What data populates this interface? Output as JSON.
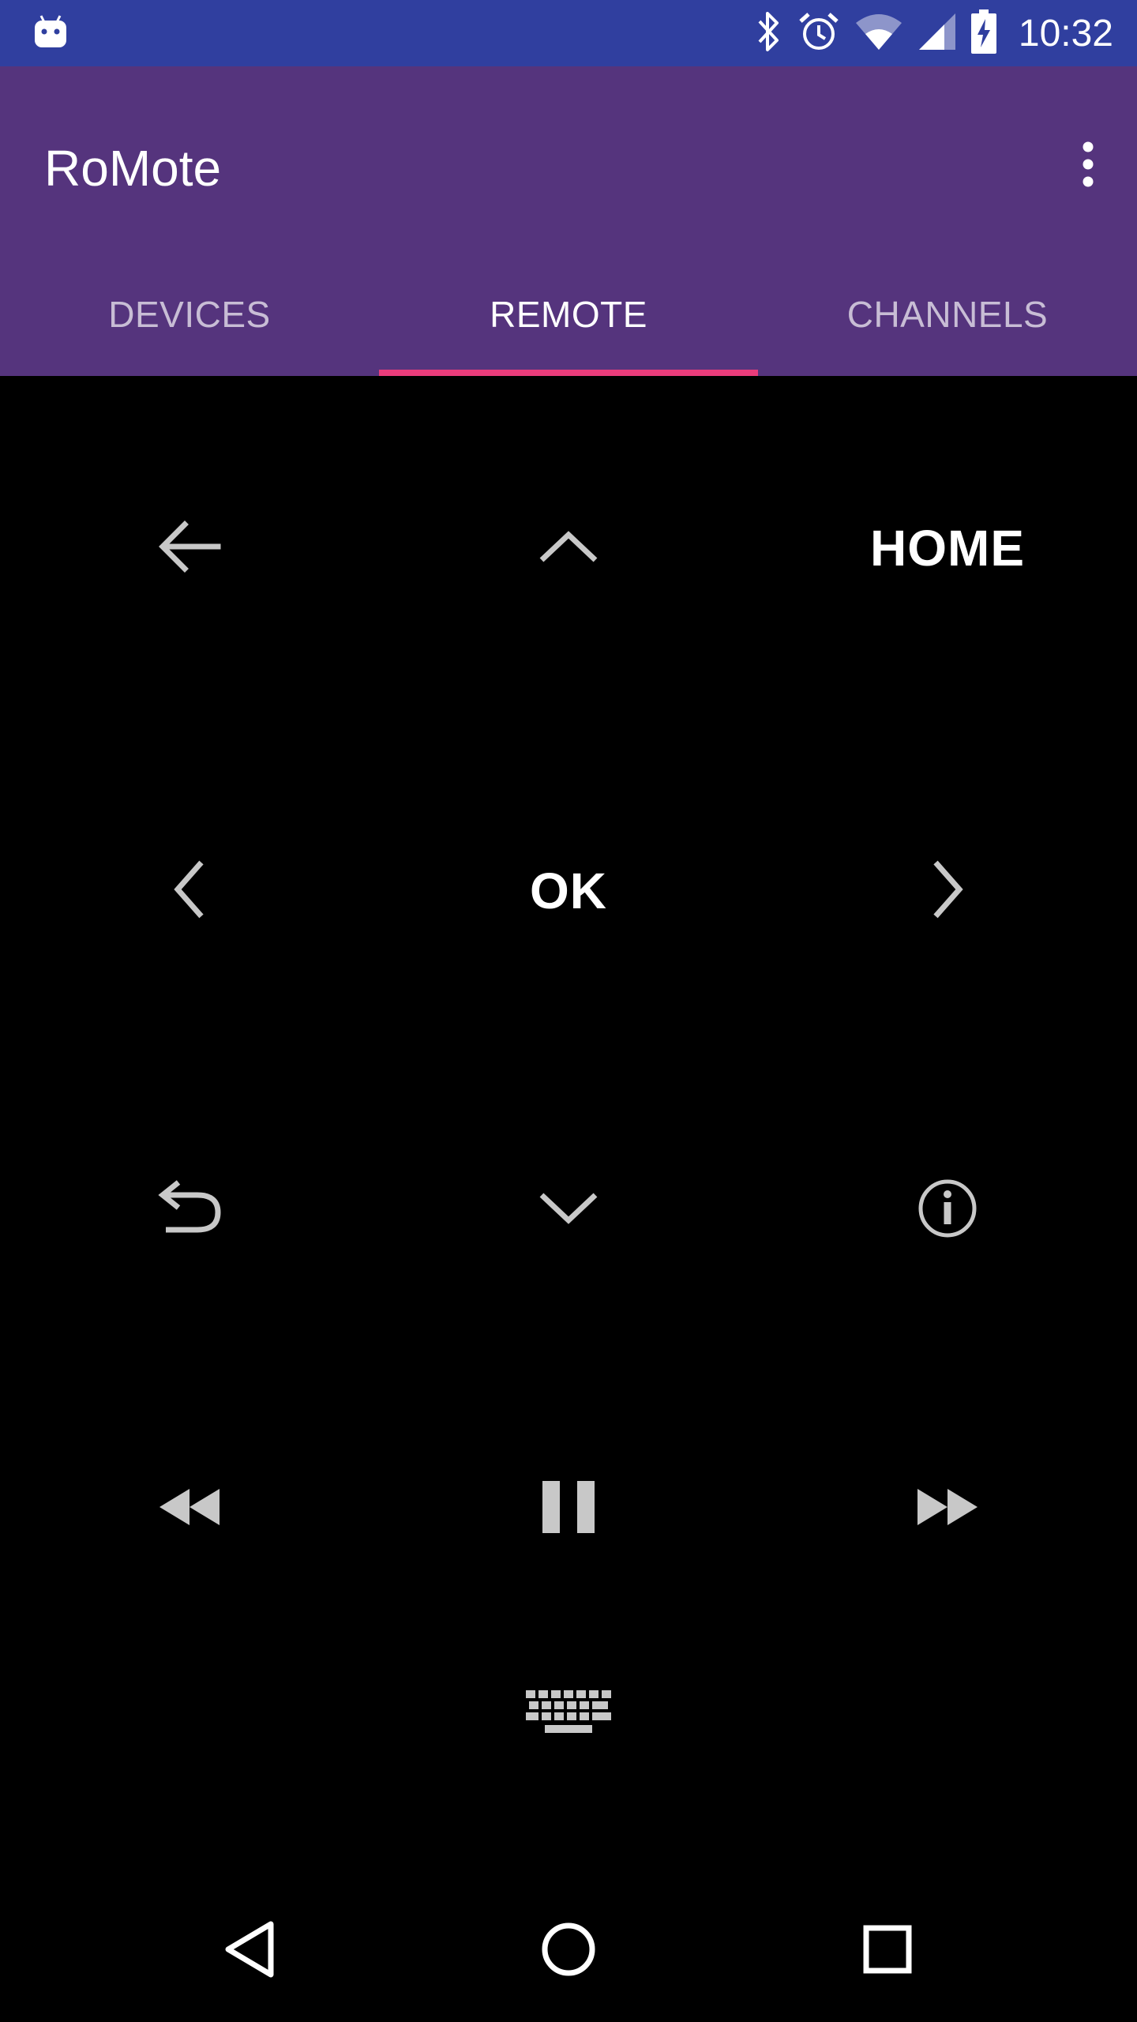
{
  "status_bar": {
    "time": "10:32",
    "icons": [
      "android-icon",
      "bluetooth-icon",
      "alarm-icon",
      "wifi-icon",
      "signal-icon",
      "battery-charging-icon"
    ],
    "color": "#303f9f"
  },
  "app_bar": {
    "title": "RoMote",
    "color": "#55347d",
    "overflow_icon": "more-vert-icon"
  },
  "tabs": [
    {
      "label": "DEVICES",
      "active": false
    },
    {
      "label": "REMOTE",
      "active": true
    },
    {
      "label": "CHANNELS",
      "active": false
    }
  ],
  "tab_indicator_color": "#ea3c7b",
  "remote": {
    "back_icon": "arrow-back-icon",
    "up_icon": "chevron-up-icon",
    "home_label": "HOME",
    "left_icon": "chevron-left-icon",
    "ok_label": "OK",
    "right_icon": "chevron-right-icon",
    "replay_icon": "undo-icon",
    "down_icon": "chevron-down-icon",
    "info_icon": "info-icon",
    "rewind_icon": "rewind-icon",
    "play_pause_icon": "pause-icon",
    "fast_forward_icon": "fast-forward-icon",
    "keyboard_icon": "keyboard-icon"
  },
  "nav_bar": {
    "back_icon": "nav-back-icon",
    "home_icon": "nav-home-icon",
    "recents_icon": "nav-recents-icon"
  }
}
